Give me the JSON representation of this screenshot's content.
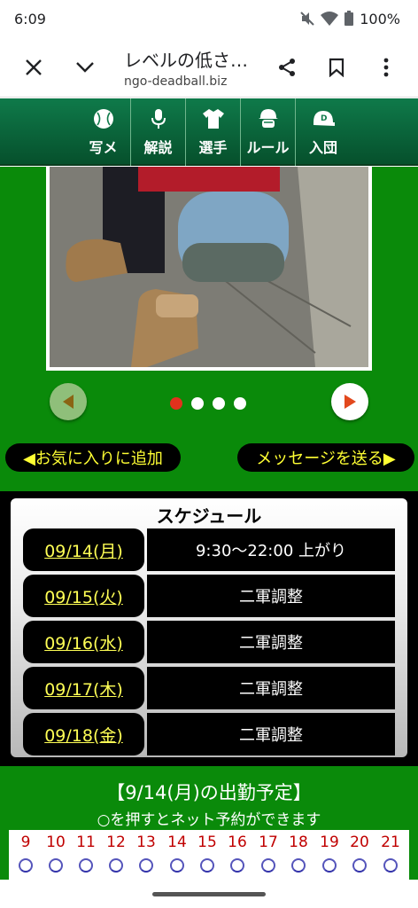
{
  "status_bar": {
    "time": "6:09",
    "battery": "100%",
    "icons": [
      "mute-icon",
      "wifi-icon",
      "battery-icon"
    ]
  },
  "browser": {
    "title": "レベルの低さ…",
    "url": "ngo-deadball.biz"
  },
  "nav": [
    {
      "label": "写メ",
      "icon": "baseball-icon"
    },
    {
      "label": "解説",
      "icon": "microphone-icon"
    },
    {
      "label": "選手",
      "icon": "uniform-icon"
    },
    {
      "label": "ルール",
      "icon": "umpire-icon"
    },
    {
      "label": "入団",
      "icon": "cap-icon"
    }
  ],
  "carousel": {
    "dot_count": 4,
    "active_index": 0
  },
  "buttons": {
    "favorite": "◀お気に入りに追加",
    "message": "メッセージを送る▶"
  },
  "schedule": {
    "title": "スケジュール",
    "rows": [
      {
        "date": "09/14(月)",
        "desc": "9:30〜22:00 上がり"
      },
      {
        "date": "09/15(火)",
        "desc": "二軍調整"
      },
      {
        "date": "09/16(水)",
        "desc": "二軍調整"
      },
      {
        "date": "09/17(木)",
        "desc": "二軍調整"
      },
      {
        "date": "09/18(金)",
        "desc": "二軍調整"
      }
    ]
  },
  "attendance": {
    "title": "【9/14(月)の出勤予定】",
    "subtitle": "○を押すとネット予約ができます",
    "hours": [
      "9",
      "10",
      "11",
      "12",
      "13",
      "14",
      "15",
      "16",
      "17",
      "18",
      "19",
      "20",
      "21"
    ]
  },
  "colors": {
    "nav_green": "#0f7a4a",
    "page_green": "#0a8a0a",
    "link_yellow": "#ffff55",
    "hour_red": "#c00000"
  }
}
